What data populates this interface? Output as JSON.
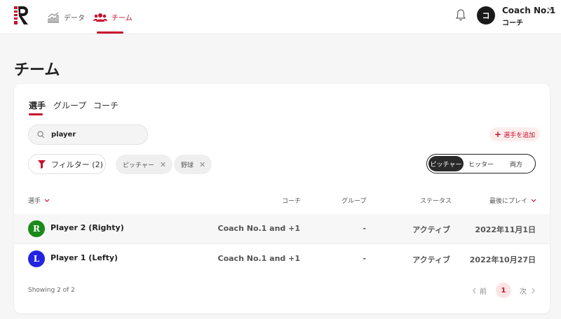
{
  "nav": {
    "data_label": "データ",
    "team_label": "チーム"
  },
  "user": {
    "avatar_initial": "コ",
    "name": "Coach No.1",
    "role": "コーチ"
  },
  "page": {
    "title": "チーム"
  },
  "tabs": [
    {
      "label": "選手",
      "active": true
    },
    {
      "label": "グループ",
      "active": false
    },
    {
      "label": "コーチ",
      "active": false
    }
  ],
  "search": {
    "value": "player"
  },
  "add_button": {
    "label": "選手を追加"
  },
  "filter": {
    "label": "フィルター (2)"
  },
  "chips": [
    {
      "label": "ピッチャー"
    },
    {
      "label": "野球"
    }
  ],
  "segment": {
    "options": [
      "ピッチャー",
      "ヒッター",
      "両方"
    ],
    "selected": "ピッチャー"
  },
  "table": {
    "headers": {
      "player": "選手",
      "coach": "コーチ",
      "group": "グループ",
      "status": "ステータス",
      "last_played": "最後にプレイ"
    },
    "rows": [
      {
        "badge": "R",
        "badge_color": "#1a8a1a",
        "name": "Player 2 (Righty)",
        "coach": "Coach No.1 and +1",
        "group": "-",
        "status": "アクティブ",
        "last_played": "2022年11月1日"
      },
      {
        "badge": "L",
        "badge_color": "#2323e0",
        "name": "Player 1 (Lefty)",
        "coach": "Coach No.1 and +1",
        "group": "-",
        "status": "アクティブ",
        "last_played": "2022年10月27日"
      }
    ]
  },
  "pagination": {
    "showing": "Showing 2 of 2",
    "prev_label": "前",
    "current": "1",
    "next_label": "次"
  },
  "colors": {
    "accent": "#c8102e"
  }
}
